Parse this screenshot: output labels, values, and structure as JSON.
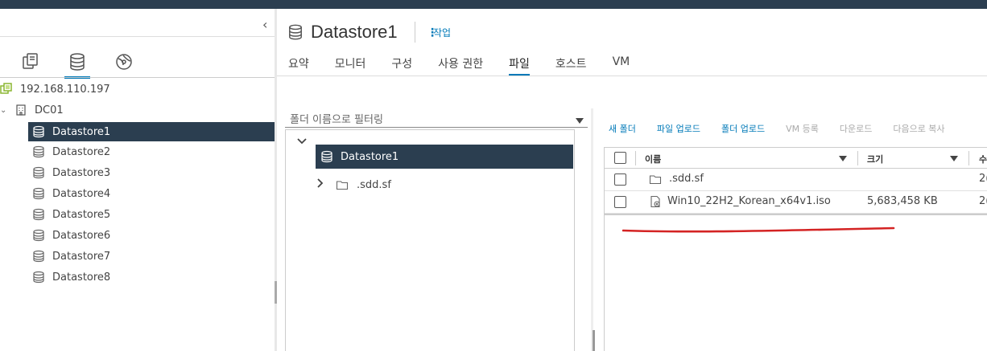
{
  "nav": {
    "collapse_glyph": "‹",
    "icons": [
      "hosts-clusters-icon",
      "storage-icon",
      "network-icon"
    ],
    "tree": [
      {
        "label": "192.168.110.197",
        "icon": "vcenter-icon",
        "level": 0
      },
      {
        "label": "DC01",
        "icon": "datacenter-icon",
        "level": 1
      },
      {
        "label": "Datastore1",
        "icon": "datastore-icon",
        "level": 2,
        "selected": true
      },
      {
        "label": "Datastore2",
        "icon": "datastore-icon",
        "level": 2
      },
      {
        "label": "Datastore3",
        "icon": "datastore-icon",
        "level": 2
      },
      {
        "label": "Datastore4",
        "icon": "datastore-icon",
        "level": 2
      },
      {
        "label": "Datastore5",
        "icon": "datastore-icon",
        "level": 2
      },
      {
        "label": "Datastore6",
        "icon": "datastore-icon",
        "level": 2
      },
      {
        "label": "Datastore7",
        "icon": "datastore-icon",
        "level": 2
      },
      {
        "label": "Datastore8",
        "icon": "datastore-icon",
        "level": 2
      }
    ]
  },
  "header": {
    "title": "Datastore1",
    "actions_label": "작업"
  },
  "tabs": [
    {
      "label": "요약"
    },
    {
      "label": "모니터"
    },
    {
      "label": "구성"
    },
    {
      "label": "사용 권한"
    },
    {
      "label": "파일",
      "active": true
    },
    {
      "label": "호스트"
    },
    {
      "label": "VM"
    }
  ],
  "folder_panel": {
    "filter_placeholder": "폴더 이름으로 필터링",
    "root": "Datastore1",
    "children": [
      ".sdd.sf"
    ]
  },
  "toolbar": {
    "new_folder": "새 폴더",
    "upload_file": "파일 업로드",
    "upload_folder": "폴더 업로드",
    "register_vm": "VM 등록",
    "download": "다운로드",
    "copy_to": "다음으로 복사"
  },
  "file_grid": {
    "columns": {
      "name": "이름",
      "size": "크기",
      "modified": "수"
    },
    "rows": [
      {
        "name": ".sdd.sf",
        "size": "",
        "modified": "2(",
        "type": "folder"
      },
      {
        "name": "Win10_22H2_Korean_x64v1.iso",
        "size": "5,683,458 KB",
        "modified": "2(",
        "type": "iso"
      }
    ]
  },
  "colors": {
    "topbar": "#2b3e50",
    "selected_bg": "#2b3e50",
    "accent": "#0079b8",
    "annotation": "#d42323"
  }
}
